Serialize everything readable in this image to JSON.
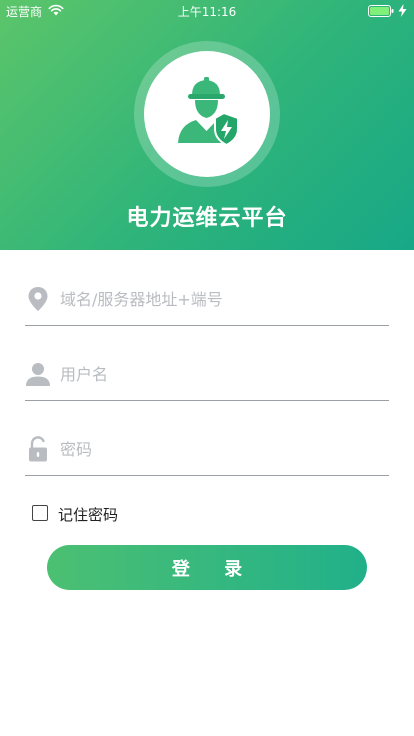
{
  "status_bar": {
    "carrier": "运营商",
    "time": "上午11:16",
    "icons": [
      "wifi-icon",
      "battery-icon",
      "charging-bolt-icon"
    ]
  },
  "header": {
    "logo_icon": "power-worker-icon",
    "title": "电力运维云平台",
    "colors": {
      "gradient_start": "#5cc56a",
      "gradient_end": "#17a887"
    }
  },
  "form": {
    "server": {
      "icon": "location-pin-icon",
      "placeholder": "域名/服务器地址+端号",
      "value": ""
    },
    "username": {
      "icon": "user-icon",
      "placeholder": "用户名",
      "value": ""
    },
    "password": {
      "icon": "lock-icon",
      "placeholder": "密码",
      "value": ""
    },
    "remember": {
      "label": "记住密码",
      "checked": false
    },
    "login_label": "登 录"
  }
}
